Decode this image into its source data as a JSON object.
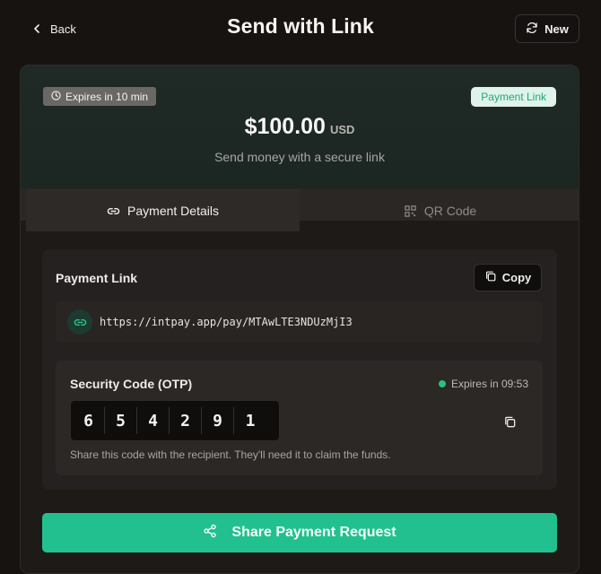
{
  "header": {
    "back_label": "Back",
    "title": "Send with Link",
    "new_label": "New"
  },
  "hero": {
    "expires_label": "Expires in 10 min",
    "badge": "Payment Link",
    "amount": "$100.00",
    "currency": "USD",
    "subtitle": "Send money with a secure link"
  },
  "tabs": [
    {
      "label": "Payment Details",
      "icon": "link-icon",
      "active": true
    },
    {
      "label": "QR Code",
      "icon": "qr-code-icon",
      "active": false
    }
  ],
  "payment_link": {
    "label": "Payment Link",
    "copy_label": "Copy",
    "url": "https://intpay.app/pay/MTAwLTE3NDUzMjI3"
  },
  "otp": {
    "title": "Security Code (OTP)",
    "expiry": "Expires in 09:53",
    "digits": [
      "6",
      "5",
      "4",
      "2",
      "9",
      "1"
    ],
    "note": "Share this code with the recipient. They'll need it to claim the funds."
  },
  "share_button_label": "Share Payment Request",
  "colors": {
    "background": "#171310",
    "accent": "#22c08f",
    "hero": "#1f2a26",
    "status_dot": "#27c27a"
  }
}
